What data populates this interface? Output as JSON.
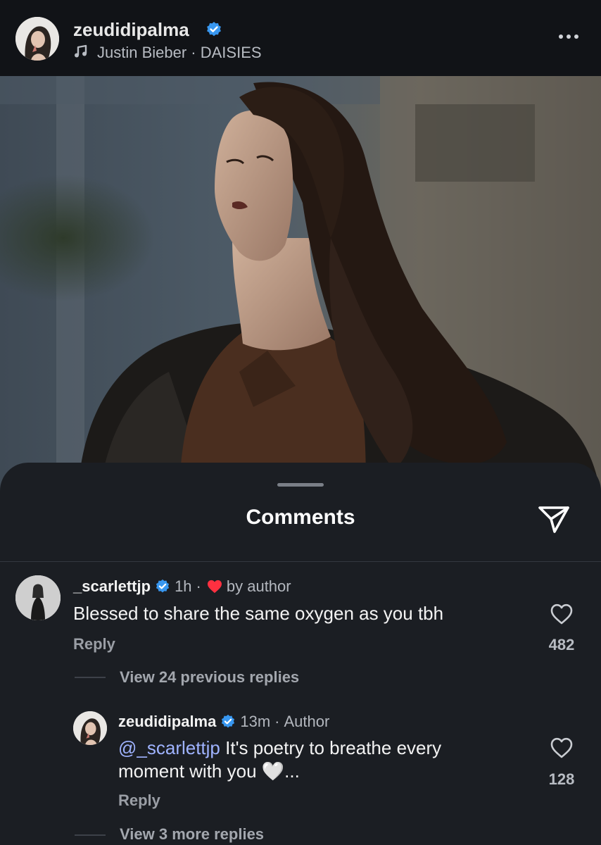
{
  "post": {
    "username": "zeudidipalma",
    "music": "Justin Bieber · DAISIES"
  },
  "sheet": {
    "title": "Comments"
  },
  "comments": [
    {
      "username": "_scarlettjp",
      "time": "1h",
      "author_liked": "by author",
      "text": "Blessed to share the same oxygen as you tbh",
      "reply_label": "Reply",
      "likes": "482",
      "view_replies": "View 24 previous replies"
    }
  ],
  "replies": [
    {
      "username": "zeudidipalma",
      "time": "13m",
      "badge": "Author",
      "mention": "@_scarlettjp",
      "text_line1": " It's poetry to breathe every",
      "text_line2": "moment with you 🤍...",
      "reply_label": "Reply",
      "likes": "128",
      "view_more": "View 3 more replies"
    }
  ],
  "colors": {
    "verified": "#3897f0",
    "like_heart": "#ff3040",
    "mention": "#9fb3ff",
    "header_bg": "#111317",
    "sheet_bg": "#1b1e23"
  },
  "icons": [
    "verified-icon",
    "music-note-icon",
    "more-options-icon",
    "share-send-icon",
    "heart-icon"
  ]
}
